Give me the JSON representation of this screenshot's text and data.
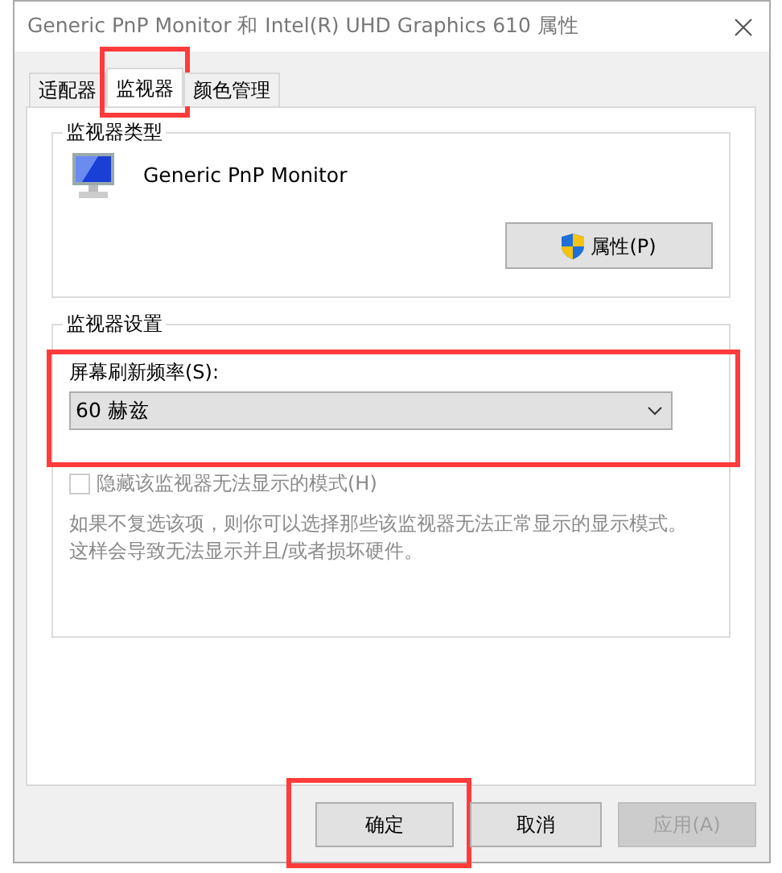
{
  "window": {
    "title": "Generic PnP Monitor 和 Intel(R) UHD Graphics 610 属性"
  },
  "tabs": [
    {
      "label": "适配器",
      "selected": false,
      "highlighted": false
    },
    {
      "label": "监视器",
      "selected": true,
      "highlighted": true
    },
    {
      "label": "颜色管理",
      "selected": false,
      "highlighted": false
    }
  ],
  "monitor_type": {
    "legend": "监视器类型",
    "name": "Generic PnP Monitor",
    "properties_button": "属性(P)"
  },
  "monitor_settings": {
    "legend": "监视器设置",
    "refresh_rate": {
      "label": "屏幕刷新频率(S):",
      "value": "60 赫兹",
      "highlighted": true
    },
    "hide_modes": {
      "label": "隐藏该监视器无法显示的模式(H)",
      "checked": false,
      "disabled": true
    },
    "description_lines": [
      "如果不复选该项，则你可以选择那些该监视器无法正常显示的显示模式。",
      "这样会导致无法显示并且/或者损坏硬件。"
    ]
  },
  "buttons": [
    {
      "label": "确定",
      "disabled": false,
      "highlighted": true
    },
    {
      "label": "取消",
      "disabled": false,
      "highlighted": false
    },
    {
      "label": "应用(A)",
      "disabled": true,
      "highlighted": false
    }
  ]
}
